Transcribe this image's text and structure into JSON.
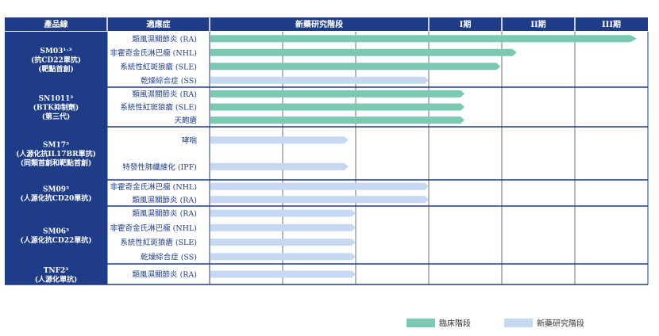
{
  "colors": {
    "header_bg": "#1f3c88",
    "border": "#1f3c88",
    "clinical": "#7cc9b3",
    "preclinical": "#c7d9f2",
    "indication_text": "#1f3c88"
  },
  "chart_data": {
    "type": "bar",
    "orientation": "horizontal",
    "headers": [
      "產品線",
      "適應症",
      "新藥研究階段",
      "I期",
      "II期",
      "III期"
    ],
    "stages": [
      "新藥研究階段",
      "I期",
      "II期",
      "III期"
    ],
    "xlim": [
      0,
      5
    ],
    "legend": [
      {
        "name": "臨床階段",
        "color_key": "clinical"
      },
      {
        "name": "新藥研究階段",
        "color_key": "preclinical"
      }
    ],
    "legend_position": "bottom-right",
    "products": [
      {
        "name_lines": [
          "SM03¹˒³",
          "(抗CD22單抗)",
          "(靶點首創)"
        ],
        "indications": [
          {
            "label": "類風濕關節炎 (RA)",
            "value": 4.0,
            "phase": "clinical",
            "arrow": true
          },
          {
            "label": "非霍奇金氏淋巴瘤 (NHL)",
            "value": 2.85,
            "phase": "clinical"
          },
          {
            "label": "系統性紅斑狼瘡 (SLE)",
            "value": 2.6,
            "phase": "clinical"
          },
          {
            "label": "乾燥綜合症 (SS)",
            "value": 1.5,
            "phase": "preclinical"
          }
        ]
      },
      {
        "name_lines": [
          "SN1011²",
          "(BTK抑制劑)",
          "(第三代)"
        ],
        "indications": [
          {
            "label": "類風濕關節炎 (RA)",
            "value": 2.05,
            "phase": "clinical"
          },
          {
            "label": "系統性紅斑狼瘡 (SLE)",
            "value": 2.05,
            "phase": "clinical"
          },
          {
            "label": "天皰瘡",
            "value": 2.05,
            "phase": "clinical"
          }
        ]
      },
      {
        "name_lines": [
          "SM17³",
          "(人源化抗IL17BR單抗)",
          "(同類首創和靶點首創)"
        ],
        "indications": [
          {
            "label": "哮喘",
            "value": 0.95,
            "phase": "preclinical"
          },
          {
            "label": "特發性肺纖維化 (IPF)",
            "value": 0.95,
            "phase": "preclinical"
          }
        ]
      },
      {
        "name_lines": [
          "SM09³",
          "(人源化抗CD20單抗)"
        ],
        "indications": [
          {
            "label": "非霍奇金氏淋巴瘤 (NHL)",
            "value": 1.5,
            "phase": "preclinical"
          },
          {
            "label": "類風濕關節炎 (RA)",
            "value": 1.5,
            "phase": "preclinical"
          }
        ]
      },
      {
        "name_lines": [
          "SM06³",
          "(人源化抗CD22單抗)"
        ],
        "indications": [
          {
            "label": "類風濕關節炎 (RA)",
            "value": 1.0,
            "phase": "preclinical"
          },
          {
            "label": "非霍奇金氏淋巴瘤 (NHL)",
            "value": 1.0,
            "phase": "preclinical"
          },
          {
            "label": "系統性紅斑狼瘡 (SLE)",
            "value": 1.0,
            "phase": "preclinical"
          },
          {
            "label": "乾燥綜合症 (SS)",
            "value": 1.0,
            "phase": "preclinical"
          }
        ]
      },
      {
        "name_lines": [
          "TNF2³",
          "(人源化單抗)"
        ],
        "indications": [
          {
            "label": "類風濕關節炎 (RA)",
            "value": 1.0,
            "phase": "preclinical"
          }
        ]
      }
    ]
  }
}
